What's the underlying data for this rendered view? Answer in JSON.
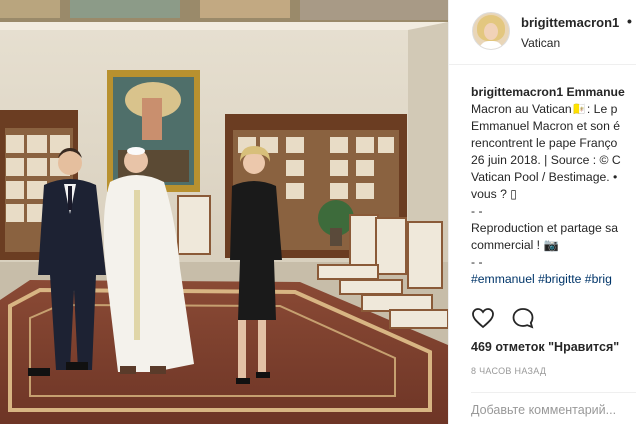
{
  "post": {
    "username": "brigittemacron1",
    "more_dot": "•",
    "location": "Vatican",
    "caption_lines": [
      "brigittemacron1 Emmanue",
      "Macron au Vatican🇻🇦: Le p",
      "Emmanuel Macron et son é",
      "rencontrent le pape Franço",
      "26 juin 2018. | Source : © C",
      "Vatican Pool / Bestimage. •",
      "vous ? ▯",
      "- -",
      "Reproduction et partage sa",
      "commercial ! 📷",
      "- -",
      "#emmanuel #brigitte #brig"
    ],
    "likes": "469 отметок \"Нравится\"",
    "time_ago": "8 ЧАСОВ НАЗАД",
    "comment_placeholder": "Добавьте комментарий..."
  },
  "icons": {
    "like": "heart-icon",
    "comment": "comment-icon"
  },
  "colors": {
    "hashtag": "#003569",
    "text": "#262626",
    "muted": "#999999"
  }
}
